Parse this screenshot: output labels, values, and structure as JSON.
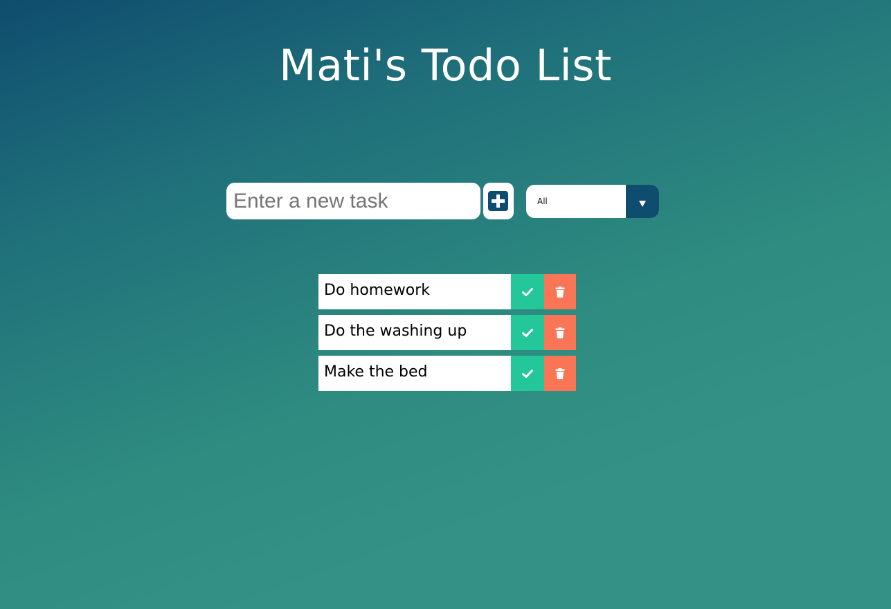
{
  "header": {
    "title": "Mati's Todo List"
  },
  "form": {
    "input_placeholder": "Enter a new task",
    "input_value": "",
    "add_icon": "plus-square-icon",
    "filter": {
      "selected": "All",
      "arrow_icon": "caret-down-icon"
    }
  },
  "todos": [
    {
      "text": "Do homework",
      "complete_icon": "check-icon",
      "delete_icon": "trash-icon"
    },
    {
      "text": "Do the washing up",
      "complete_icon": "check-icon",
      "delete_icon": "trash-icon"
    },
    {
      "text": "Make the bed",
      "complete_icon": "check-icon",
      "delete_icon": "trash-icon"
    }
  ],
  "colors": {
    "primary": "#0f4d6e",
    "complete": "#24c79a",
    "delete": "#fa7456",
    "background_end": "#339185"
  }
}
